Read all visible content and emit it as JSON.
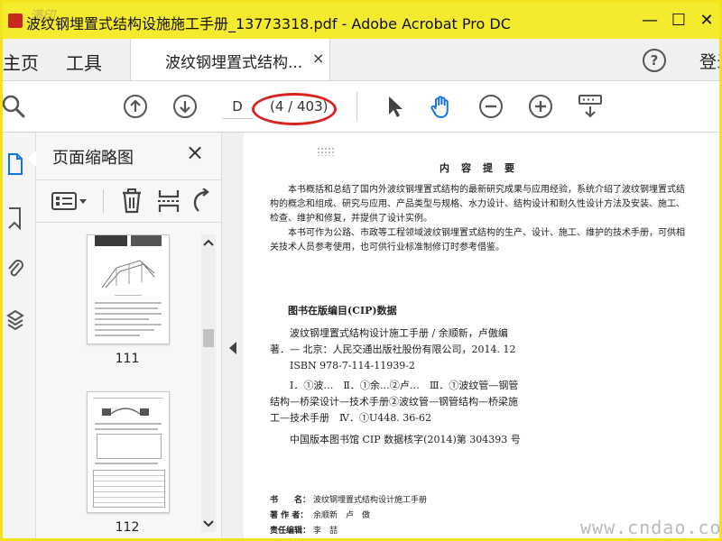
{
  "window": {
    "title": "波纹钢埋置式结构设施施工手册_13773318.pdf - Adobe Acrobat Pro DC",
    "minimize_glyph": "—",
    "maximize_glyph": "☐",
    "close_glyph": "✕",
    "tl_watermark": "满印"
  },
  "tabs": {
    "home": "主页",
    "tools": "工具",
    "document": "波纹钢埋置式结构...",
    "close_glyph": "×",
    "help_glyph": "?",
    "sign_in": "登录"
  },
  "toolbar": {
    "page_input": "D",
    "page_count": "(4 / 403)",
    "icons": [
      "search-icon",
      "prev-page-icon",
      "next-page-icon",
      "select-cursor-icon",
      "hand-tool-icon",
      "zoom-out-icon",
      "zoom-in-icon",
      "scroll-mode-icon"
    ],
    "hand_color": "#1473e6",
    "annotation_color": "#d8231e"
  },
  "rail": {
    "icons": [
      "page-thumbnails-icon",
      "bookmarks-icon",
      "attachments-icon",
      "layers-icon"
    ],
    "active_color": "#1473e6"
  },
  "panel": {
    "title": "页面缩略图",
    "close_glyph": "×",
    "tools": [
      "thumbnail-options-icon",
      "delete-page-icon",
      "extract-page-icon",
      "rotate-page-icon"
    ],
    "thumbnails": [
      {
        "page": "111"
      },
      {
        "page": "112"
      }
    ]
  },
  "document": {
    "heading": "内　容　提　要",
    "para1": "本书概括和总结了国内外波纹钢埋置式结构的最新研究成果与应用经验，系统介绍了波纹钢埋置式结构的概念和组成、研究与应用、产品类型与规格、水力设计、结构设计和耐久性设计方法及安装、施工、检查、维护和修复，并提供了设计实例。",
    "para2": "本书可作为公路、市政等工程领域波纹钢埋置式结构的生产、设计、施工、维护的技术手册，可供相关技术人员参考使用，也可供行业标准制修订时参考借鉴。",
    "cip_title": "图书在版编目(CIP)数据",
    "cip_line1": "波纹钢埋置式结构设计施工手册 / 余顺新，卢傲编",
    "cip_line2": "著．— 北京：人民交通出版社股份有限公司，2014. 12",
    "isbn": "ISBN 978-7-114-11939-2",
    "class_line1": "Ⅰ．①波…　Ⅱ．①余…②卢…　Ⅲ．①波纹管—钢管",
    "class_line2": "结构—桥梁设计—技术手册②波纹管—钢管结构—桥梁施",
    "class_line3": "工—技术手册　Ⅳ．①U448. 36-62",
    "cip_number": "中国版本图书馆 CIP 数据核字(2014)第 304393 号",
    "book_label": "书　　名：",
    "book_value": "波纹钢埋置式结构设计施工手册",
    "author_label": "著 作 者：",
    "author_value": "余顺新　卢　傲",
    "editor_label": "责任编辑：",
    "editor_value": "李　喆"
  },
  "watermark": "www.cndao.com"
}
